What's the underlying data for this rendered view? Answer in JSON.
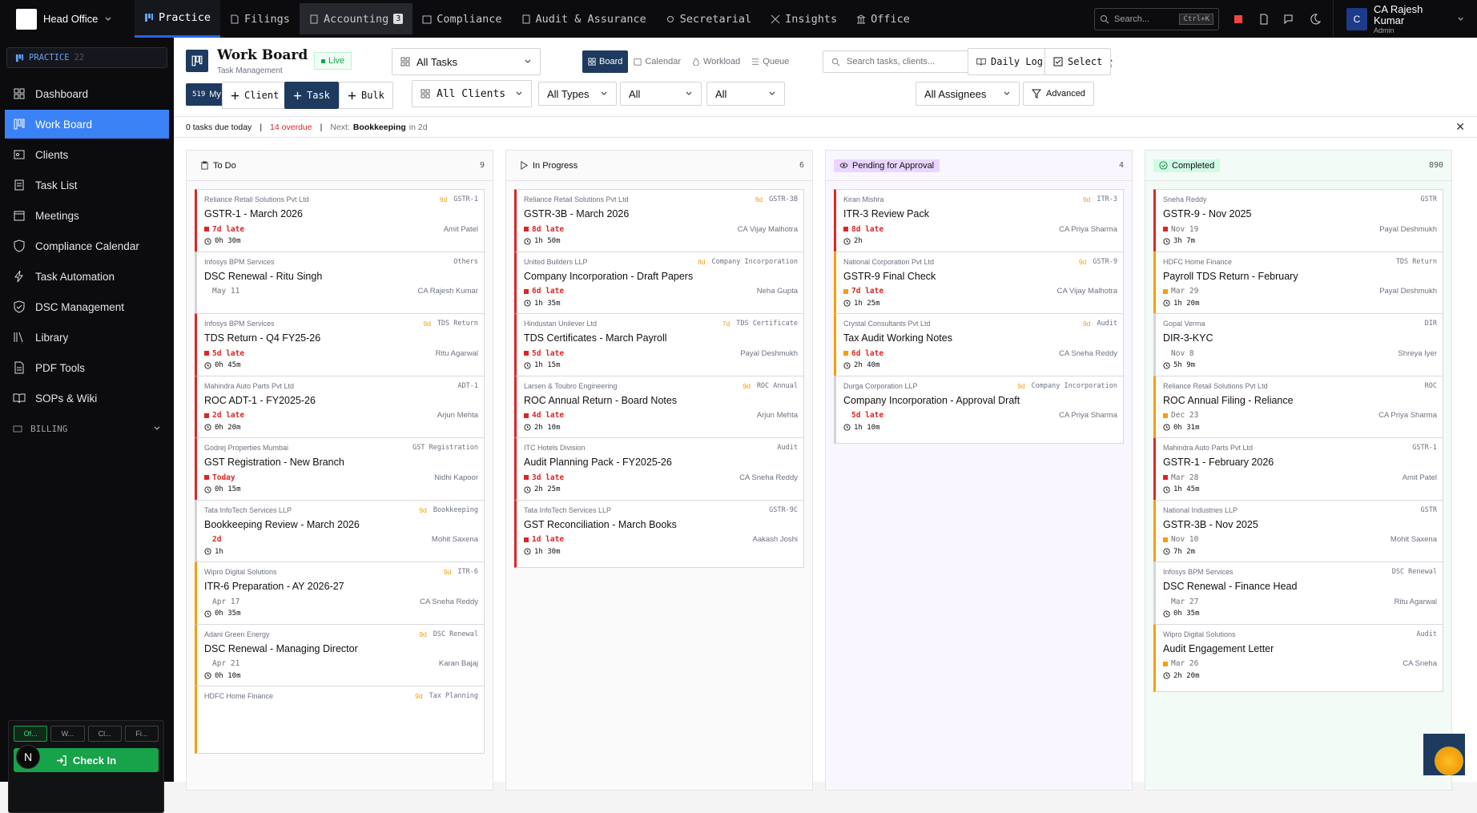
{
  "topbar": {
    "org": "Head Office",
    "nav": [
      {
        "label": "Practice",
        "active": true
      },
      {
        "label": "Filings"
      },
      {
        "label": "Accounting",
        "badge": "3"
      },
      {
        "label": "Compliance"
      },
      {
        "label": "Audit & Assurance"
      },
      {
        "label": "Secretarial"
      },
      {
        "label": "Insights"
      },
      {
        "label": "Office"
      }
    ],
    "search_placeholder": "Search...",
    "search_kbd": "Ctrl+K",
    "user_initial": "C",
    "user_name": "CA Rajesh Kumar",
    "user_role": "Admin"
  },
  "sidebar": {
    "section": "PRACTICE",
    "section_count": "22",
    "items": [
      {
        "label": "Dashboard"
      },
      {
        "label": "Work Board",
        "active": true
      },
      {
        "label": "Clients"
      },
      {
        "label": "Task List"
      },
      {
        "label": "Meetings"
      },
      {
        "label": "Compliance Calendar"
      },
      {
        "label": "Task Automation"
      },
      {
        "label": "DSC Management"
      },
      {
        "label": "Library"
      },
      {
        "label": "PDF Tools"
      },
      {
        "label": "SOPs & Wiki"
      }
    ],
    "billing": "BILLING",
    "mini_tabs": [
      "Of...",
      "W...",
      "Cl...",
      "Fi..."
    ],
    "checkin": "Check In",
    "n_avatar": "N"
  },
  "header": {
    "title": "Work Board",
    "subtitle": "Task Management",
    "live": "Live",
    "task_filter": "All Tasks",
    "views": [
      "Board",
      "Calendar",
      "Workload",
      "Queue"
    ],
    "search_placeholder": "Search tasks, clients...",
    "daily_log": "Daily Log",
    "select": "Select",
    "my_tasks_count": "519",
    "my_tasks": "My Tasks",
    "client_btn": "Client",
    "task_btn": "Task",
    "bulk_btn": "Bulk",
    "clients_filter": "All Clients",
    "types_filter": "All Types",
    "filter3": "All",
    "filter4": "All",
    "assignees_filter": "All Assignees",
    "advanced": "Advanced"
  },
  "infobar": {
    "due_today": "0 tasks due today",
    "overdue": "14 overdue",
    "next_label": "Next:",
    "next_task": "Bookkeeping",
    "next_when": "in 2d"
  },
  "columns": [
    {
      "title": "To Do",
      "count": "9",
      "cards": [
        {
          "client": "Reliance Retail Solutions Pvt Ltd",
          "age": "9d",
          "type": "GSTR-1",
          "title": "GSTR-1 - March 2026",
          "status": "7d late",
          "assignee": "Amit Patel",
          "time": "0h 30m"
        },
        {
          "client": "Infosys BPM Services",
          "age": "",
          "type": "Others",
          "title": "DSC Renewal - Ritu Singh",
          "status": "May 11",
          "assignee": "CA Rajesh Kumar",
          "time": ""
        },
        {
          "client": "Infosys BPM Services",
          "age": "9d",
          "type": "TDS Return",
          "title": "TDS Return - Q4 FY25-26",
          "status": "5d late",
          "assignee": "Ritu Agarwal",
          "time": "0h 45m"
        },
        {
          "client": "Mahindra Auto Parts Pvt Ltd",
          "age": "",
          "type": "ADT-1",
          "title": "ROC ADT-1 - FY2025-26",
          "status": "2d late",
          "assignee": "Arjun Mehta",
          "time": "0h 20m"
        },
        {
          "client": "Godrej Properties Mumbai",
          "age": "",
          "type": "GST Registration",
          "title": "GST Registration - New Branch",
          "status": "Today",
          "assignee": "Nidhi Kapoor",
          "time": "0h 15m"
        },
        {
          "client": "Tata InfoTech Services LLP",
          "age": "9d",
          "type": "Bookkeeping",
          "title": "Bookkeeping Review - March 2026",
          "status": "2d",
          "assignee": "Mohit Saxena",
          "time": "1h"
        },
        {
          "client": "Wipro Digital Solutions",
          "age": "9d",
          "type": "ITR-6",
          "title": "ITR-6 Preparation - AY 2026-27",
          "status": "Apr 17",
          "assignee": "CA Sneha Reddy",
          "time": "0h 35m"
        },
        {
          "client": "Adani Green Energy",
          "age": "9d",
          "type": "DSC Renewal",
          "title": "DSC Renewal - Managing Director",
          "status": "Apr 21",
          "assignee": "Karan Bajaj",
          "time": "0h 10m"
        },
        {
          "client": "HDFC Home Finance",
          "age": "9d",
          "type": "Tax Planning",
          "title": "",
          "status": "",
          "assignee": "",
          "time": ""
        }
      ]
    },
    {
      "title": "In Progress",
      "count": "6",
      "cards": [
        {
          "client": "Reliance Retail Solutions Pvt Ltd",
          "age": "9d",
          "type": "GSTR-3B",
          "title": "GSTR-3B - March 2026",
          "status": "8d late",
          "assignee": "CA Vijay Malhotra",
          "time": "1h 50m"
        },
        {
          "client": "United Builders LLP",
          "age": "8d",
          "type": "Company Incorporation",
          "title": "Company Incorporation - Draft Papers",
          "status": "6d late",
          "assignee": "Neha Gupta",
          "time": "1h 35m"
        },
        {
          "client": "Hindustan Unilever Ltd",
          "age": "7d",
          "type": "TDS Certificate",
          "title": "TDS Certificates - March Payroll",
          "status": "5d late",
          "assignee": "Payal Deshmukh",
          "time": "1h 15m"
        },
        {
          "client": "Larsen & Toubro Engineering",
          "age": "9d",
          "type": "ROC Annual",
          "title": "ROC Annual Return - Board Notes",
          "status": "4d late",
          "assignee": "Arjun Mehta",
          "time": "2h 10m"
        },
        {
          "client": "ITC Hotels Division",
          "age": "",
          "type": "Audit",
          "title": "Audit Planning Pack - FY2025-26",
          "status": "3d late",
          "assignee": "CA Sneha Reddy",
          "time": "2h 25m"
        },
        {
          "client": "Tata InfoTech Services LLP",
          "age": "",
          "type": "GSTR-9C",
          "title": "GST Reconciliation - March Books",
          "status": "1d late",
          "assignee": "Aakash Joshi",
          "time": "1h 30m"
        }
      ]
    },
    {
      "title": "Pending for Approval",
      "count": "4",
      "cards": [
        {
          "client": "Kiran Mishra",
          "age": "9d",
          "type": "ITR-3",
          "title": "ITR-3 Review Pack",
          "status": "8d late",
          "assignee": "CA Priya Sharma",
          "time": "2h"
        },
        {
          "client": "National Corporation Pvt Ltd",
          "age": "9d",
          "type": "GSTR-9",
          "title": "GSTR-9 Final Check",
          "status": "7d late",
          "assignee": "CA Vijay Malhotra",
          "time": "1h 25m"
        },
        {
          "client": "Crystal Consultants Pvt Ltd",
          "age": "9d",
          "type": "Audit",
          "title": "Tax Audit Working Notes",
          "status": "6d late",
          "assignee": "CA Sneha Reddy",
          "time": "2h 40m"
        },
        {
          "client": "Durga Corporation LLP",
          "age": "9d",
          "type": "Company Incorporation",
          "title": "Company Incorporation - Approval Draft",
          "status": "5d late",
          "assignee": "CA Priya Sharma",
          "time": "1h 10m"
        }
      ]
    },
    {
      "title": "Completed",
      "count": "890",
      "cards": [
        {
          "client": "Sneha Reddy",
          "age": "",
          "type": "GSTR",
          "title": "GSTR-9 - Nov 2025",
          "status": "Nov 19",
          "assignee": "Payal Deshmukh",
          "time": "3h 7m"
        },
        {
          "client": "HDFC Home Finance",
          "age": "",
          "type": "TDS Return",
          "title": "Payroll TDS Return - February",
          "status": "Mar 29",
          "assignee": "Payal Deshmukh",
          "time": "1h 20m"
        },
        {
          "client": "Gopal Verma",
          "age": "",
          "type": "DIR",
          "title": "DIR-3-KYC",
          "status": "Nov 8",
          "assignee": "Shreya Iyer",
          "time": "5h 9m"
        },
        {
          "client": "Reliance Retail Solutions Pvt Ltd",
          "age": "",
          "type": "ROC",
          "title": "ROC Annual Filing - Reliance",
          "status": "Dec 23",
          "assignee": "CA Priya Sharma",
          "time": "0h 31m"
        },
        {
          "client": "Mahindra Auto Parts Pvt Ltd",
          "age": "",
          "type": "GSTR-1",
          "title": "GSTR-1 - February 2026",
          "status": "Mar 28",
          "assignee": "Amit Patel",
          "time": "1h 45m"
        },
        {
          "client": "National Industries LLP",
          "age": "",
          "type": "GSTR",
          "title": "GSTR-3B - Nov 2025",
          "status": "Nov 10",
          "assignee": "Mohit Saxena",
          "time": "7h 2m"
        },
        {
          "client": "Infosys BPM Services",
          "age": "",
          "type": "DSC Renewal",
          "title": "DSC Renewal - Finance Head",
          "status": "Mar 27",
          "assignee": "Ritu Agarwal",
          "time": "0h 35m"
        },
        {
          "client": "Wipro Digital Solutions",
          "age": "",
          "type": "Audit",
          "title": "Audit Engagement Letter",
          "status": "Mar 26",
          "assignee": "CA Sneha",
          "time": "2h 20m"
        }
      ]
    }
  ]
}
